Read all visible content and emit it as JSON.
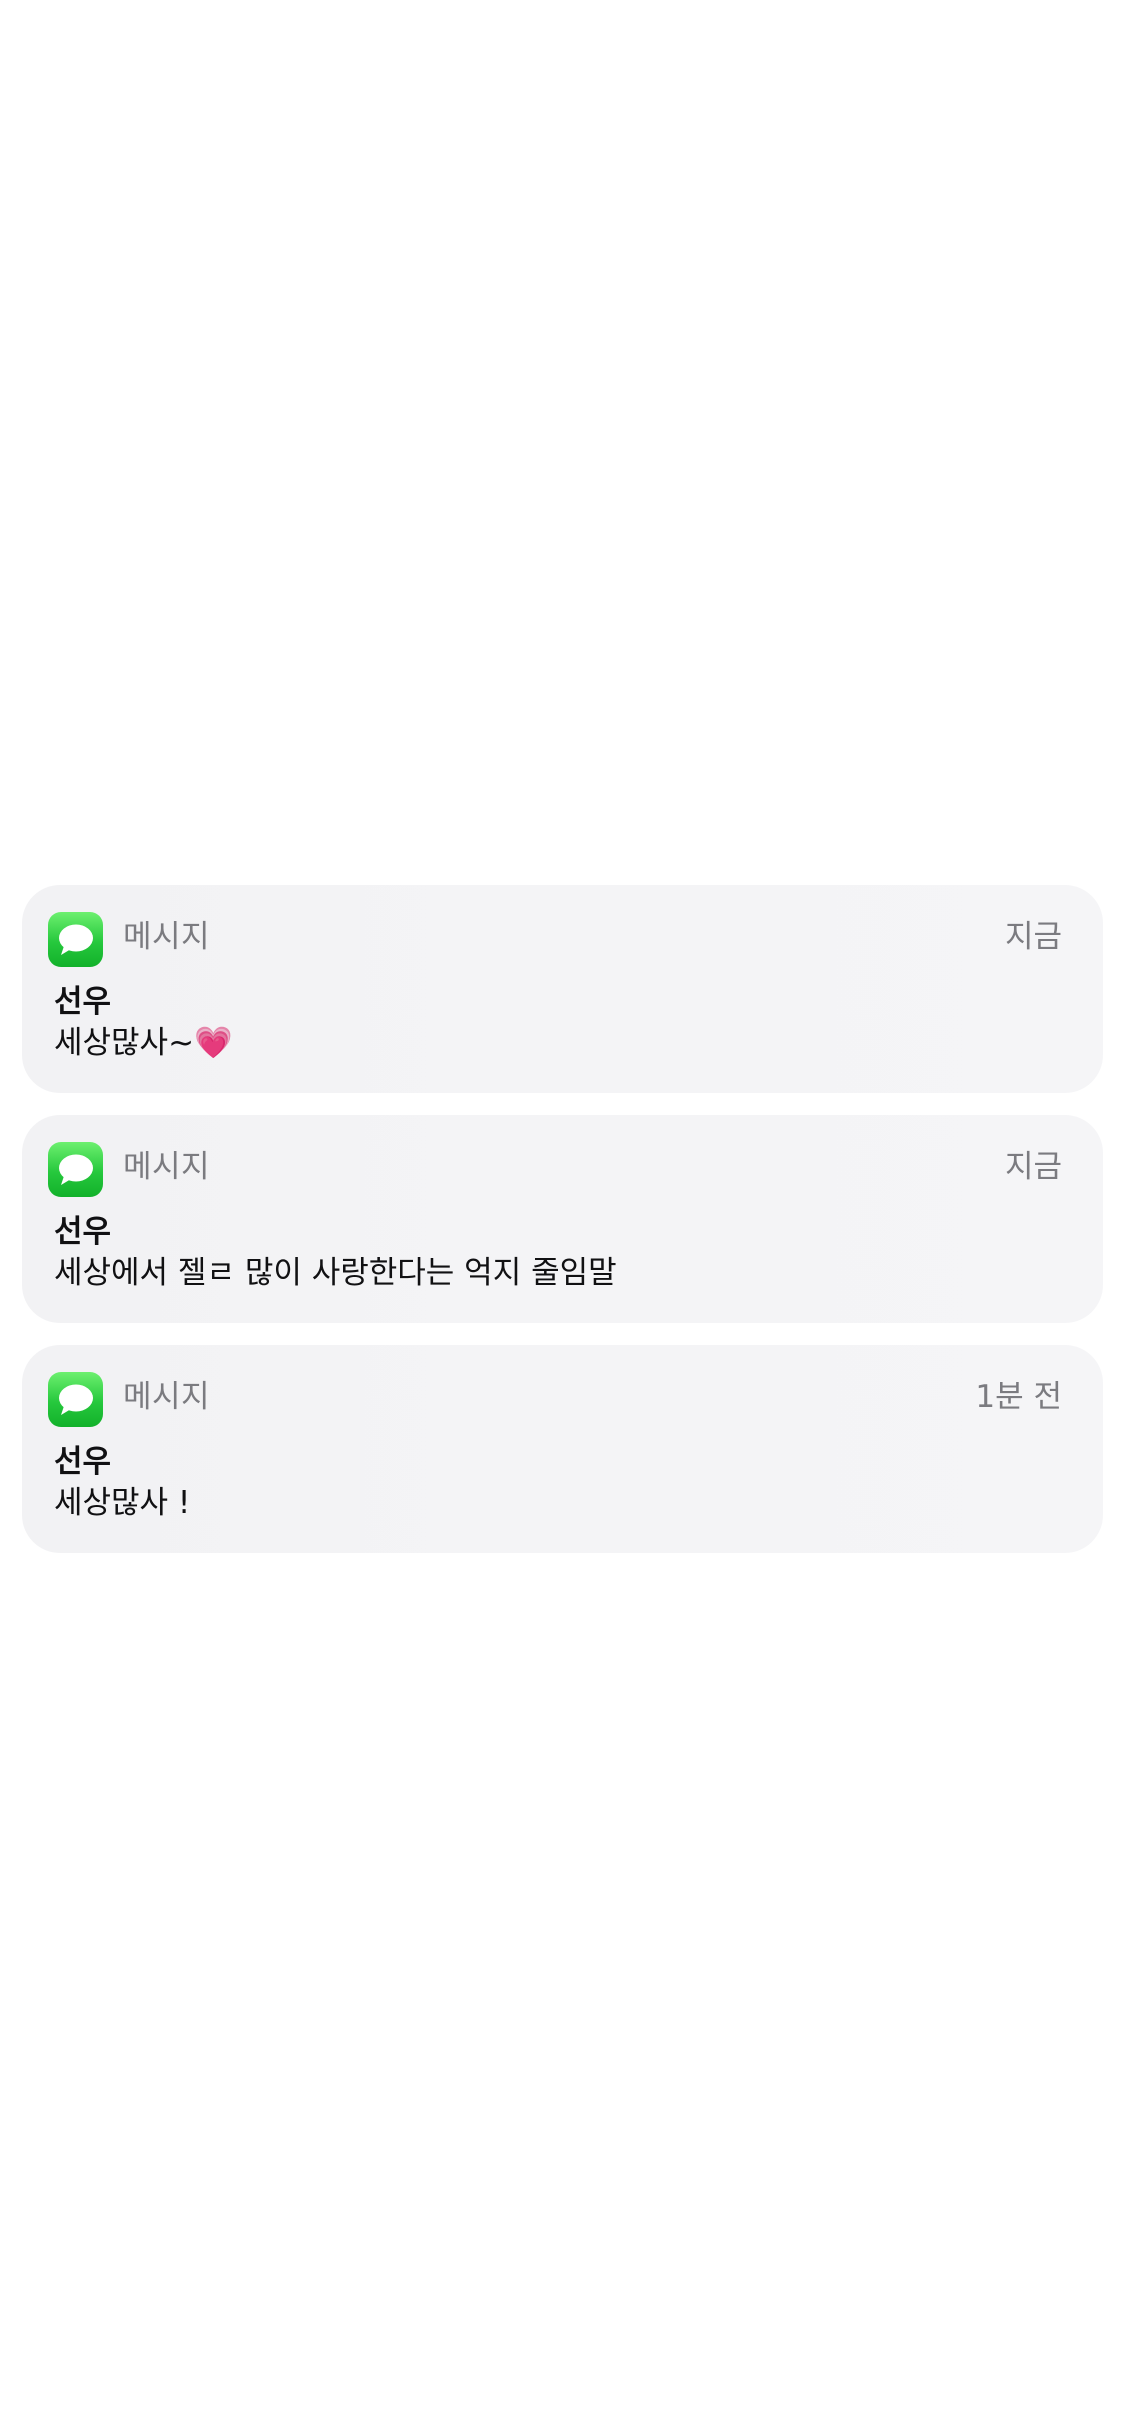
{
  "notifications": [
    {
      "app_name": "메시지",
      "app_icon": "messages-icon",
      "time": "지금",
      "sender": "선우",
      "message": "세상많사~💗"
    },
    {
      "app_name": "메시지",
      "app_icon": "messages-icon",
      "time": "지금",
      "sender": "선우",
      "message": "세상에서 젤ㄹ 많이 사랑한다는 억지 줄임말"
    },
    {
      "app_name": "메시지",
      "app_icon": "messages-icon",
      "time": "1분 전",
      "sender": "선우",
      "message": "세상많사 !"
    }
  ],
  "colors": {
    "card_background": "#f4f4f6",
    "app_icon_green": "#26c83d",
    "secondary_text": "#7b7b80",
    "primary_text": "#111113"
  }
}
